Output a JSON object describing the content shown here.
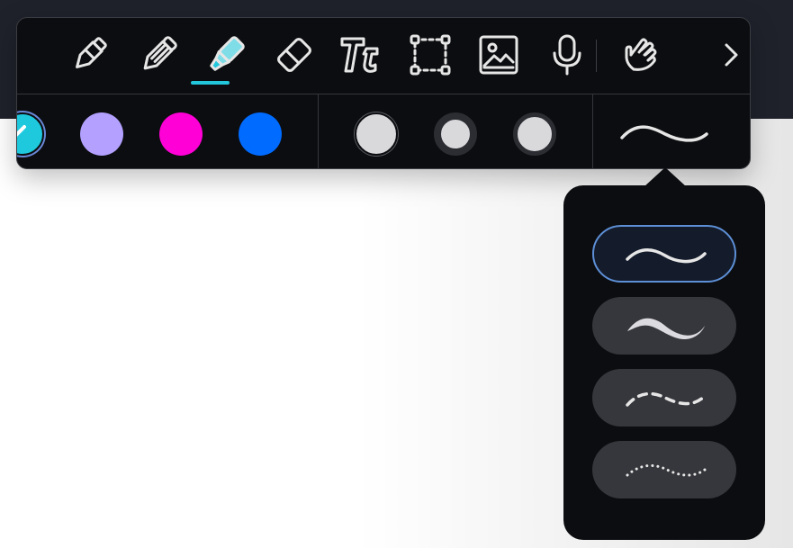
{
  "toolbar": {
    "tools": [
      {
        "name": "pen-tool",
        "icon": "pen-icon"
      },
      {
        "name": "pencil-tool",
        "icon": "pencil-icon"
      },
      {
        "name": "highlighter-tool",
        "icon": "highlighter-icon",
        "selected": true
      },
      {
        "name": "eraser-tool",
        "icon": "eraser-icon"
      },
      {
        "name": "text-tool",
        "icon": "text-icon"
      },
      {
        "name": "selection-tool",
        "icon": "lasso-selection-icon"
      },
      {
        "name": "image-tool",
        "icon": "image-icon"
      },
      {
        "name": "audio-tool",
        "icon": "microphone-icon"
      },
      {
        "name": "touch-tool",
        "icon": "hand-pointer-icon"
      }
    ],
    "more": {
      "icon": "chevron-right-icon"
    },
    "active_underline_color": "#22c7dc"
  },
  "colors": {
    "selected": "#1ec9de",
    "swatches": [
      "#b3a0ff",
      "#ff00d6",
      "#006bff"
    ]
  },
  "sizes": [
    {
      "name": "small",
      "selected": false
    },
    {
      "name": "medium",
      "selected": true
    },
    {
      "name": "large",
      "selected": false
    }
  ],
  "stroke_styles": {
    "current": "solid-thin",
    "options": [
      {
        "name": "solid-thin",
        "selected": true
      },
      {
        "name": "solid-variable",
        "selected": false
      },
      {
        "name": "dashed",
        "selected": false
      },
      {
        "name": "dotted",
        "selected": false
      }
    ]
  }
}
